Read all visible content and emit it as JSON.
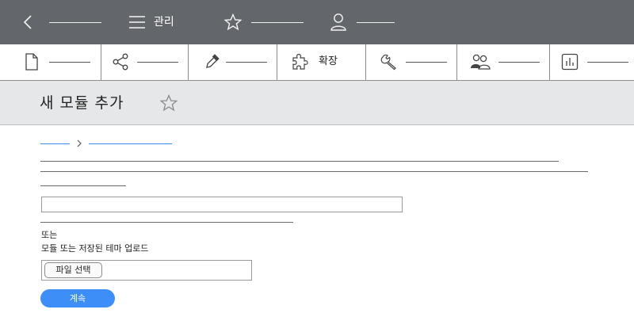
{
  "header": {
    "icons": [
      "chevron-left-icon",
      "menu-icon",
      "star-icon",
      "user-icon"
    ],
    "manage_label": "관리"
  },
  "toolbar": {
    "icons": [
      "document-icon",
      "share-icon",
      "eyedropper-icon",
      "puzzle-icon",
      "wrench-icon",
      "users-icon",
      "chart-icon"
    ],
    "extensions_label": "확장"
  },
  "page": {
    "title": "새 모듈 추가"
  },
  "form": {
    "or_label": "또는",
    "upload_label": "모듈 또는 저장된 테마 업로드",
    "file_button": "파일 선택",
    "continue_button": "계속"
  },
  "colors": {
    "header_bg": "#63666a",
    "title_bg": "#e6e7e8",
    "accent": "#3e8ef7",
    "breadcrumb": "#3b8fe8"
  }
}
